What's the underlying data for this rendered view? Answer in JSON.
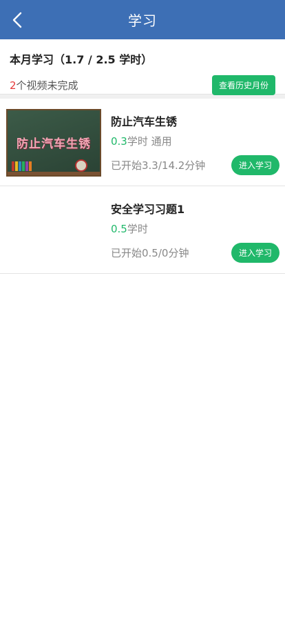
{
  "header": {
    "title": "学习"
  },
  "summary": {
    "title": "本月学习（1.7 / 2.5 学时）",
    "incomplete_count": "2",
    "incomplete_text": "个视频未完成",
    "history_button": "查看历史月份"
  },
  "courses": [
    {
      "title": "防止汽车生锈",
      "thumbnail_text": "防止汽车生锈",
      "hours_value": "0.3",
      "hours_unit": "学时",
      "tag": "通用",
      "progress": "已开始3.3/14.2分钟",
      "button": "进入学习"
    },
    {
      "title": "安全学习习题1",
      "hours_value": "0.5",
      "hours_unit": "学时",
      "progress": "已开始0.5/0分钟",
      "button": "进入学习"
    }
  ],
  "colors": {
    "header": "#3d6fb5",
    "accent": "#20b86a",
    "count": "#e5393a"
  }
}
